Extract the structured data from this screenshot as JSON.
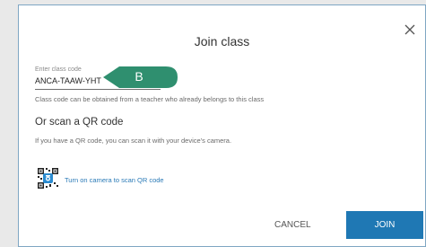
{
  "dialog": {
    "title": "Join class",
    "close_icon": "close-icon"
  },
  "class_code": {
    "label": "Enter class code",
    "value": "ANCA-TAAW-YHT",
    "helper": "Class code can be obtained from a teacher who already belongs to this class"
  },
  "callout": {
    "label": "B",
    "color": "#2f8f6f"
  },
  "qr_section": {
    "title": "Or scan a QR code",
    "description": "If you have a QR code, you can scan it with your device's camera.",
    "link": "Turn on camera to scan QR code",
    "icon": "qr-camera-icon",
    "link_color": "#2a7ab7"
  },
  "actions": {
    "cancel_label": "CANCEL",
    "join_label": "JOIN",
    "join_color": "#1f78b4"
  }
}
